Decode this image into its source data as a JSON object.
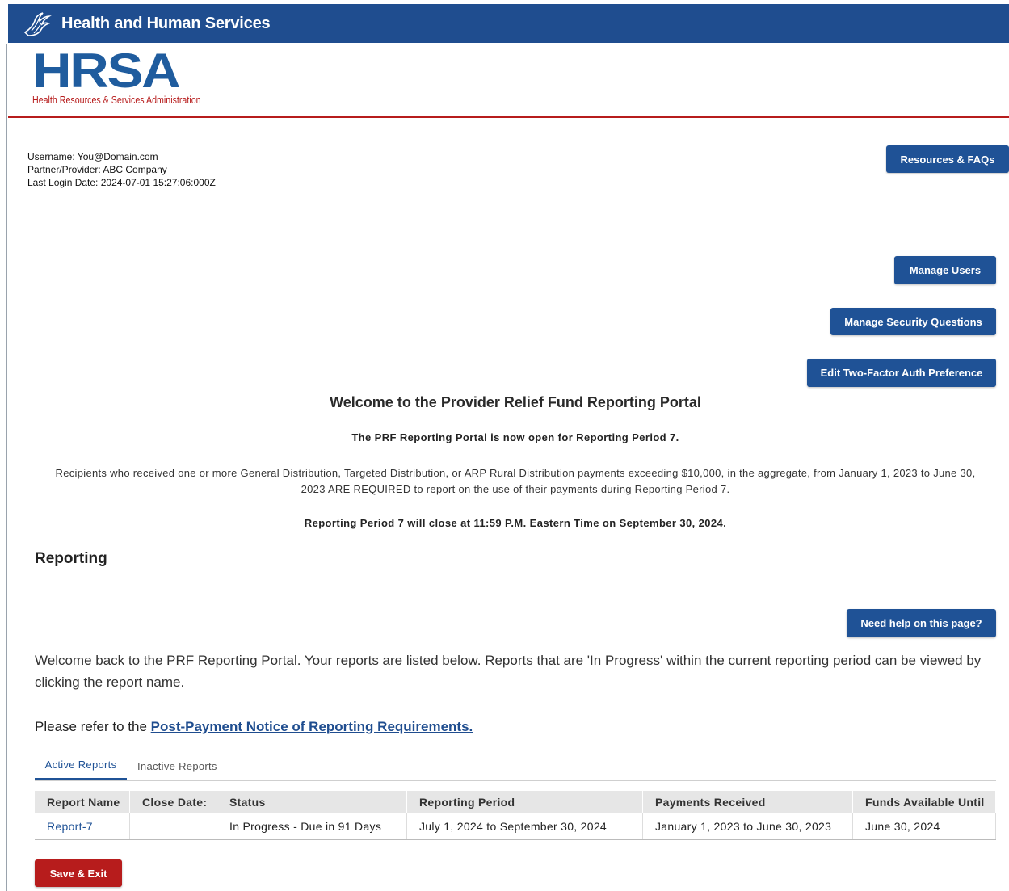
{
  "header": {
    "title": "Health and Human Services",
    "logo_icon": "hhs-eagle-icon"
  },
  "logo": {
    "text": "HRSA",
    "subtitle": "Health Resources & Services Administration"
  },
  "user": {
    "username": "Username: You@Domain.com",
    "partner": "Partner/Provider: ABC Company",
    "last_login": "Last Login Date: 2024-07-01 15:27:06:000Z"
  },
  "buttons": {
    "resources": "Resources & FAQs",
    "manage_users": "Manage Users",
    "security_questions": "Manage Security Questions",
    "two_factor": "Edit Two-Factor Auth Preference",
    "need_help": "Need help on this page?",
    "save_exit": "Save & Exit"
  },
  "welcome": {
    "title": "Welcome to the Provider Relief Fund Reporting Portal",
    "open_line": "The PRF Reporting Portal is now open for Reporting Period 7.",
    "recipients_part1": "Recipients who received one or more General Distribution, Targeted Distribution, or ARP Rural Distribution payments exceeding $10,000, in the aggregate, from January 1, 2023 to June 30, 2023 ",
    "are": "ARE",
    "required": "REQUIRED",
    "recipients_part2": " to report on the use of their payments during Reporting Period 7.",
    "close_line": "Reporting Period 7 will close at 11:59 P.M. Eastern Time on September 30, 2024."
  },
  "reporting": {
    "heading": "Reporting",
    "paragraph": "Welcome back to the PRF Reporting Portal. Your reports are listed below. Reports that are 'In Progress' within the current reporting period can be viewed by clicking the report name.",
    "refer_prefix": "Please refer to the ",
    "refer_link": "Post-Payment Notice of Reporting Requirements."
  },
  "tabs": {
    "active": "Active Reports",
    "inactive": "Inactive Reports"
  },
  "table": {
    "headers": [
      "Report Name",
      "Close Date:",
      "Status",
      "Reporting Period",
      "Payments Received",
      "Funds Available Until"
    ],
    "rows": [
      [
        "Report-7",
        "",
        "In Progress - Due in 91 Days",
        "July 1, 2024 to September 30, 2024",
        "January 1, 2023 to June 30, 2023",
        "June 30, 2024"
      ]
    ]
  },
  "colors": {
    "navy": "#1f4d8f",
    "button_blue": "#1f5296",
    "red": "#b71c1c"
  }
}
